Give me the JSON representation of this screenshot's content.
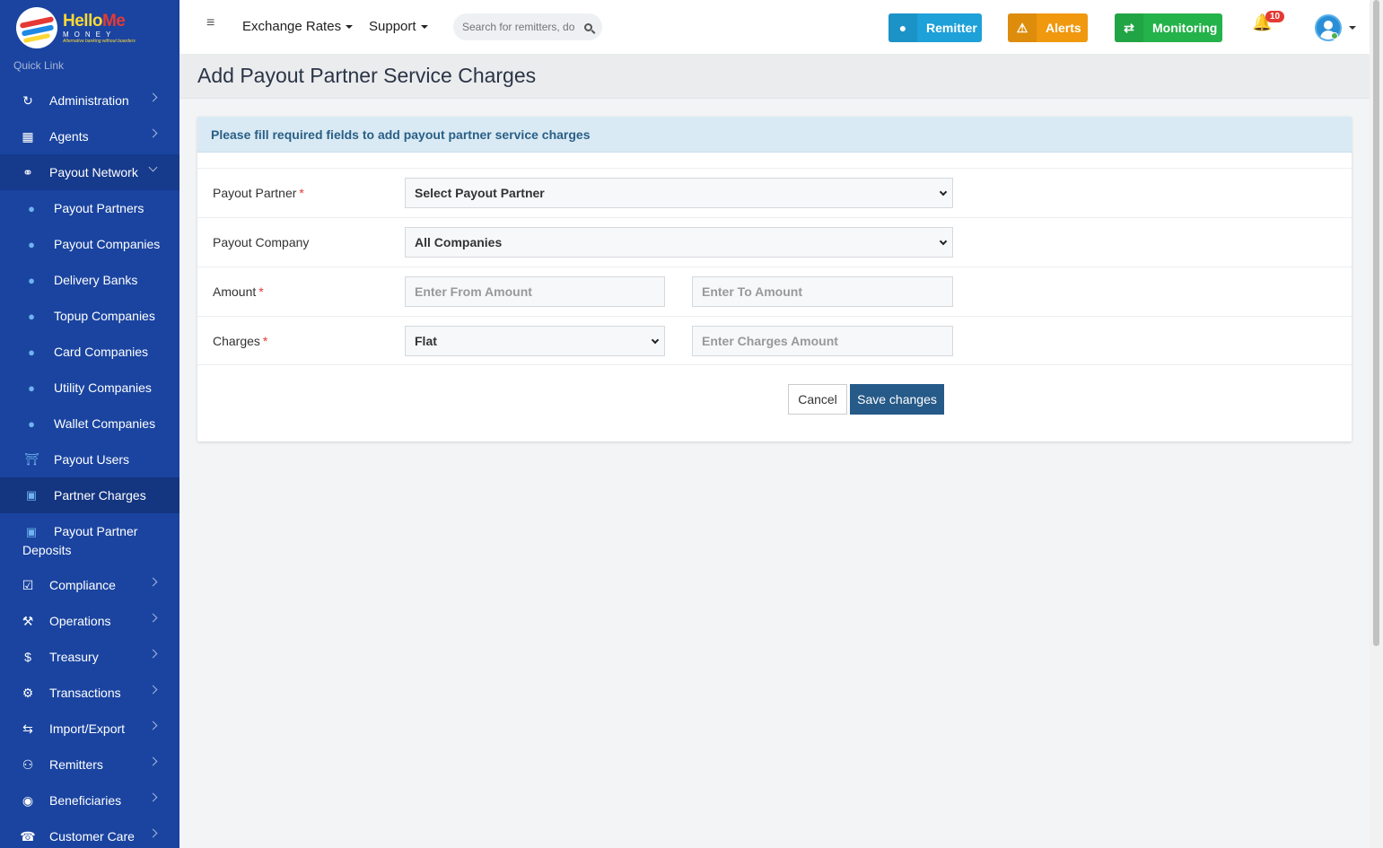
{
  "brand": {
    "name_a": "Hello",
    "name_b": "Me",
    "sub": "MONEY",
    "tagline": "Alternative banking without boarders"
  },
  "sidebar": {
    "quick_link": "Quick Link",
    "items": [
      {
        "label": "Administration",
        "icon": "sync-icon"
      },
      {
        "label": "Agents",
        "icon": "building-icon"
      },
      {
        "label": "Payout Network",
        "icon": "handshake-icon"
      }
    ],
    "sub_items": [
      {
        "label": "Payout Partners",
        "icon": "user-icon"
      },
      {
        "label": "Payout Companies",
        "icon": "user-icon"
      },
      {
        "label": "Delivery Banks",
        "icon": "user-icon"
      },
      {
        "label": "Topup Companies",
        "icon": "user-icon"
      },
      {
        "label": "Card Companies",
        "icon": "user-icon"
      },
      {
        "label": "Utility Companies",
        "icon": "user-icon"
      },
      {
        "label": "Wallet Companies",
        "icon": "user-icon"
      },
      {
        "label": "Payout Users",
        "icon": "bank-icon"
      },
      {
        "label": "Partner Charges",
        "icon": "money-icon"
      },
      {
        "label": "Payout Partner Deposits",
        "icon": "money-icon"
      }
    ],
    "bottom_items": [
      {
        "label": "Compliance",
        "icon": "check-square-icon"
      },
      {
        "label": "Operations",
        "icon": "wrench-icon"
      },
      {
        "label": "Treasury",
        "icon": "dollar-icon"
      },
      {
        "label": "Transactions",
        "icon": "cogs-icon"
      },
      {
        "label": "Import/Export",
        "icon": "shuffle-icon"
      },
      {
        "label": "Remitters",
        "icon": "users-icon"
      },
      {
        "label": "Beneficiaries",
        "icon": "user-circle-icon"
      },
      {
        "label": "Customer Care",
        "icon": "headset-icon"
      }
    ]
  },
  "topbar": {
    "exchange_rates": "Exchange Rates",
    "support": "Support",
    "search_placeholder": "Search for remitters, docs",
    "remitter": "Remitter",
    "alerts": "Alerts",
    "monitoring": "Monitoring",
    "notifications_count": "10",
    "colors": {
      "remitter": "#1ea0d8",
      "alerts": "#f0980e",
      "monitoring": "#24b24a"
    }
  },
  "page": {
    "title": "Add Payout Partner Service Charges",
    "card_header": "Please fill required fields to add payout partner service charges",
    "form": {
      "payout_partner_label": "Payout Partner",
      "payout_partner_value": "Select Payout Partner",
      "payout_company_label": "Payout Company",
      "payout_company_value": "All Companies",
      "amount_label": "Amount",
      "from_placeholder": "Enter From Amount",
      "to_placeholder": "Enter To Amount",
      "charges_label": "Charges",
      "charges_type": "Flat",
      "charges_placeholder": "Enter Charges Amount",
      "required_mark": "*"
    },
    "cancel": "Cancel",
    "save": "Save changes"
  }
}
